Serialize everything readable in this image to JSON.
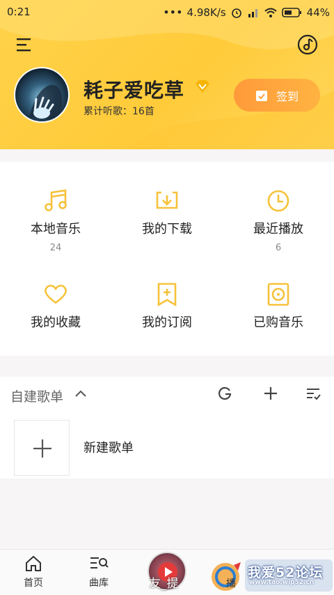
{
  "status_bar": {
    "time": "0:21",
    "speed": "4.98K/s",
    "battery": "44%"
  },
  "header": {
    "menu_icon": "hamburger-icon",
    "music_icon": "music-note-icon"
  },
  "profile": {
    "username": "耗子爱吃草",
    "listen_count": "累计听歌：16首",
    "vip_icon": "vip-diamond-icon"
  },
  "checkin": {
    "label": "签到",
    "icon": "calendar-check-icon"
  },
  "grid": [
    {
      "label": "本地音乐",
      "count": "24",
      "icon": "music-note-icon"
    },
    {
      "label": "我的下载",
      "count": "",
      "icon": "download-icon"
    },
    {
      "label": "最近播放",
      "count": "6",
      "icon": "clock-icon"
    },
    {
      "label": "我的收藏",
      "count": "",
      "icon": "heart-icon"
    },
    {
      "label": "我的订阅",
      "count": "",
      "icon": "bookmark-plus-icon"
    },
    {
      "label": "已购音乐",
      "count": "",
      "icon": "disc-icon"
    }
  ],
  "playlists": {
    "title": "自建歌单",
    "new_label": "新建歌单"
  },
  "tabbar": [
    {
      "label": "首页",
      "icon": "home-icon"
    },
    {
      "label": "曲库",
      "icon": "library-search-icon"
    },
    {
      "label": "友_提",
      "icon": "play-disc-icon"
    },
    {
      "label": "播",
      "icon": "radio-icon"
    }
  ],
  "watermark": {
    "text": "我爱52论坛",
    "url": "www.tao.wip52.cn"
  },
  "colors": {
    "accent": "#ffcb3a",
    "button": "#ff9f3b",
    "icon_yellow": "#f6c23a"
  }
}
